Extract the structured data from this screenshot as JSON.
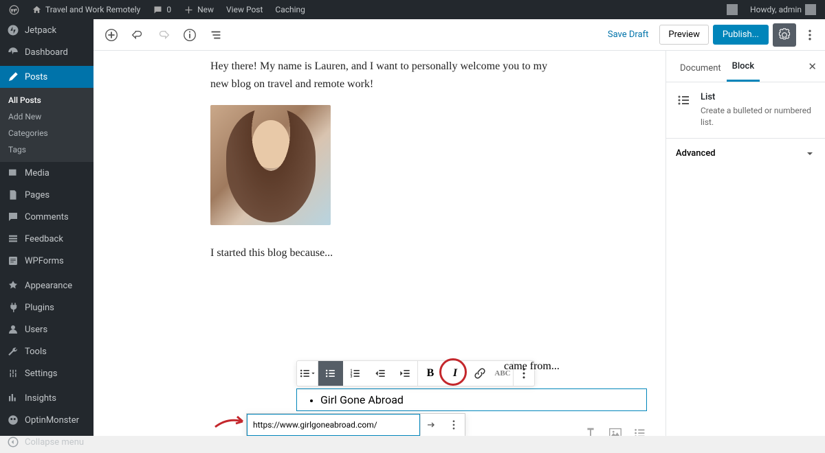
{
  "admin_bar": {
    "site_name": "Travel and Work Remotely",
    "comments_count": "0",
    "new_label": "New",
    "view_post": "View Post",
    "caching": "Caching",
    "howdy": "Howdy, admin"
  },
  "sidebar": {
    "items": [
      "Jetpack",
      "Dashboard",
      "Posts",
      "Media",
      "Pages",
      "Comments",
      "Feedback",
      "WPForms",
      "Appearance",
      "Plugins",
      "Users",
      "Tools",
      "Settings",
      "Insights",
      "OptinMonster"
    ],
    "posts_sub": [
      "All Posts",
      "Add New",
      "Categories",
      "Tags"
    ],
    "collapse": "Collapse menu"
  },
  "editor": {
    "save_draft": "Save Draft",
    "preview": "Preview",
    "publish": "Publish..."
  },
  "content": {
    "intro": "Hey there! My name is Lauren, and I want to personally welcome you to my new blog on travel and remote work!",
    "started": "I started this blog because...",
    "came_from": "came from...",
    "list_item_1": "Girl Gone Abroad"
  },
  "link": {
    "url": "https://www.girlgoneabroad.com/"
  },
  "settings": {
    "tab1": "Document",
    "tab2": "Block",
    "block_name": "List",
    "block_desc": "Create a bulleted or numbered list.",
    "advanced": "Advanced"
  }
}
